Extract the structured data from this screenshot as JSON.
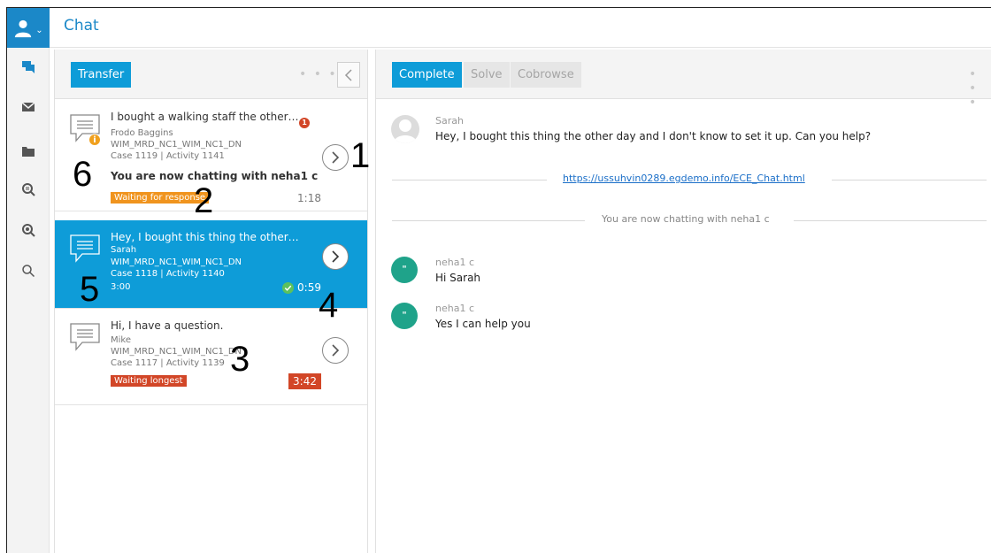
{
  "header": {
    "title": "Chat",
    "user_menu_icon": "user-icon",
    "caret": "⌄"
  },
  "nav_rail": {
    "items": [
      "chat-icon",
      "email-icon",
      "folder-icon",
      "search-activity-icon",
      "search-case-icon",
      "search-icon"
    ]
  },
  "queue": {
    "transfer_label": "Transfer",
    "dots": "• • •",
    "cards": [
      {
        "summary": "I bought a walking staff the other d...",
        "name": "Frodo Baggins",
        "queue": "WIM_MRD_NC1_WIM_NC1_DN",
        "case": "Case 1119  |  Activity 1141",
        "last_message": "You are now chatting with neha1 c",
        "badge": "Waiting for response",
        "timer": "1:18",
        "unread_count": "1",
        "info_glyph": "i"
      },
      {
        "summary": "Hey, I bought this thing the other day and...",
        "name": "Sarah",
        "queue": "WIM_MRD_NC1_WIM_NC1_DN",
        "case": "Case 1118  |  Activity 1140",
        "extra": "3:00",
        "timer": "0:59"
      },
      {
        "summary": "Hi, I have a question.",
        "name": "Mike",
        "queue": "WIM_MRD_NC1_WIM_NC1_DN",
        "case": "Case 1117  |  Activity 1139",
        "badge": "Waiting longest",
        "timer": "3:42"
      }
    ]
  },
  "annotations": [
    "1",
    "2",
    "3",
    "4",
    "5",
    "6"
  ],
  "conversation": {
    "actions": {
      "complete": "Complete",
      "solve": "Solve",
      "cobrowse": "Cobrowse"
    },
    "dots": "• • •",
    "messages": [
      {
        "author": "Sarah",
        "text": "Hey, I bought this thing the other day and I don't know to set it up. Can you help?"
      },
      {
        "author": "neha1 c",
        "text": "Hi Sarah"
      },
      {
        "author": "neha1 c",
        "text": "Yes I can help you"
      }
    ],
    "link": "https://ussuhvin0289.egdemo.info/ECE_Chat.html",
    "system_notice": "You are now chatting with neha1 c",
    "agent_avatar_glyph": "\""
  },
  "colors": {
    "brand": "#1b88c8",
    "primary_button": "#0e9cd8",
    "warning": "#f0941e",
    "danger": "#d24627",
    "agent_avatar": "#1fa38a"
  }
}
